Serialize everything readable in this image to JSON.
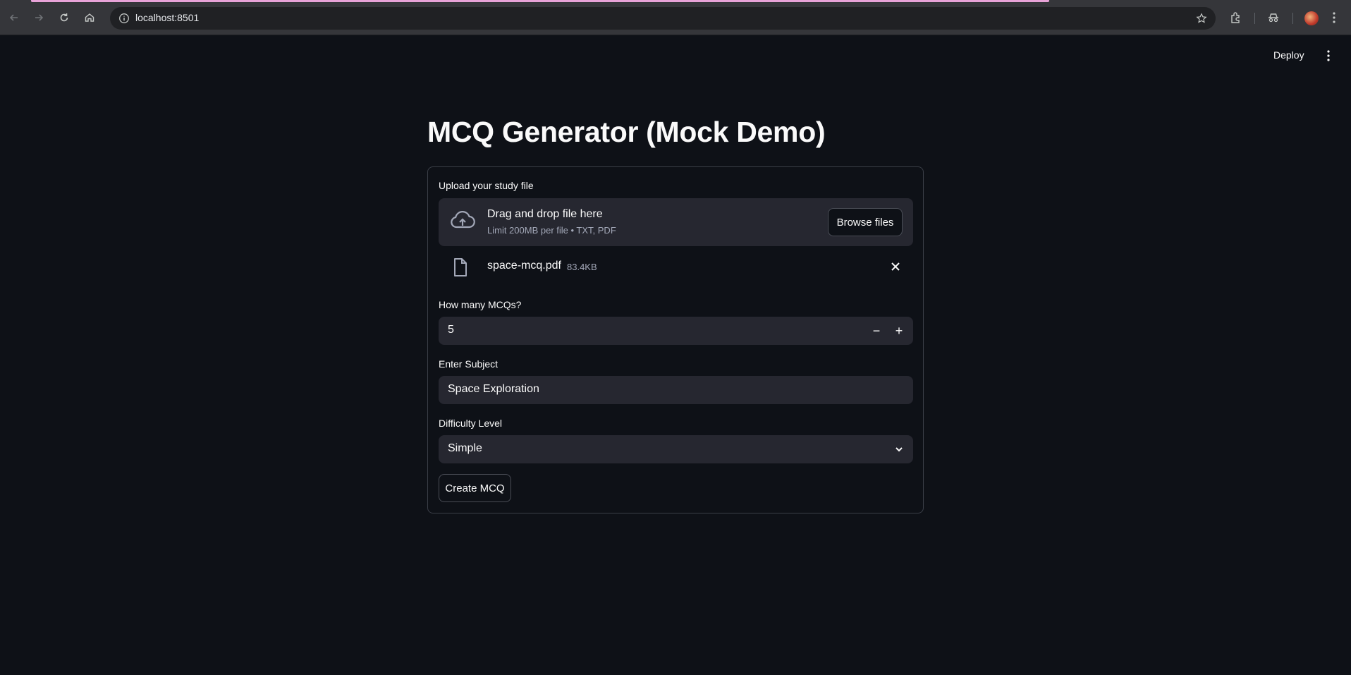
{
  "browser": {
    "url": "localhost:8501",
    "back_icon": "arrow-left-icon",
    "forward_icon": "arrow-right-icon",
    "reload_icon": "reload-icon",
    "home_icon": "home-icon"
  },
  "header": {
    "deploy_label": "Deploy"
  },
  "app": {
    "title": "MCQ Generator (Mock Demo)"
  },
  "uploader": {
    "label": "Upload your study file",
    "drop_title": "Drag and drop file here",
    "drop_subtitle": "Limit 200MB per file • TXT, PDF",
    "browse_label": "Browse files",
    "file_name": "space-mcq.pdf",
    "file_size": "83.4KB"
  },
  "mcq_count": {
    "label": "How many MCQs?",
    "value": "5",
    "minus": "−",
    "plus": "+"
  },
  "subject": {
    "label": "Enter Subject",
    "value": "Space Exploration"
  },
  "difficulty": {
    "label": "Difficulty Level",
    "selected": "Simple"
  },
  "actions": {
    "create_label": "Create MCQ"
  },
  "colors": {
    "background": "#0e1117",
    "surface": "#262730",
    "border": "#3b3f48",
    "text": "#fafafa",
    "muted": "#a3a8b8"
  }
}
